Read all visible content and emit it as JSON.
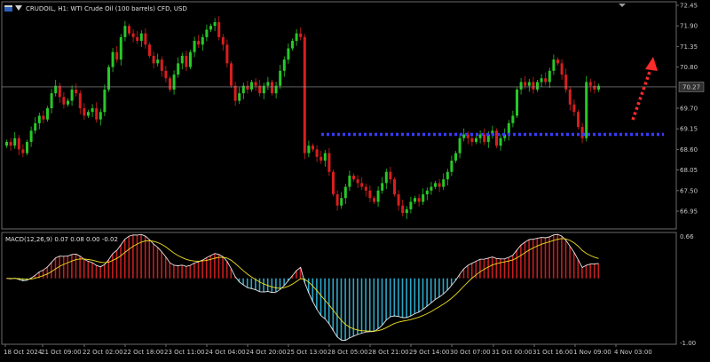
{
  "window": {
    "title": "CRUDOIL, H1: WTI Crude Oil (100 barrels) CFD, USD",
    "macd_label": "MACD(12,26,9) 0.07 0.08 0.00 -0.02"
  },
  "colors": {
    "background": "#000000",
    "bull": "#27c827",
    "bear": "#d81e1e",
    "support_line": "#3a3aff",
    "arrow": "#ff2a2a",
    "macd_line": "#e8e8e8",
    "signal_line": "#f0e020",
    "hist_pos": "#c81e1e",
    "hist_neg": "#2aa7c8",
    "bid_line": "#9a9a9a"
  },
  "icons": [
    "chart-flag-icon",
    "dropdown-arrow-icon"
  ],
  "current_price": "70.27",
  "chart_data": {
    "type": "candlestick",
    "title": "CRUDOIL, H1: WTI Crude Oil (100 barrels) CFD, USD",
    "y_ticks": [
      "72.45",
      "71.90",
      "71.35",
      "70.80",
      "70.27",
      "69.70",
      "69.15",
      "68.60",
      "68.05",
      "67.50",
      "66.95"
    ],
    "y_range": [
      66.5,
      72.5
    ],
    "x_ticks": [
      "18 Oct 2024",
      "21 Oct 09:00",
      "22 Oct 02:00",
      "22 Oct 18:00",
      "23 Oct 11:00",
      "24 Oct 04:00",
      "24 Oct 20:00",
      "25 Oct 13:00",
      "28 Oct 05:00",
      "28 Oct 21:00",
      "29 Oct 14:00",
      "30 Oct 07:00",
      "31 Oct 00:00",
      "31 Oct 16:00",
      "1 Nov 09:00",
      "4 Nov 03:00"
    ],
    "support_level": 69.0,
    "bid_level": 70.27,
    "closes": [
      68.8,
      68.7,
      68.9,
      68.6,
      68.5,
      68.8,
      69.1,
      69.3,
      69.5,
      69.4,
      69.7,
      70.1,
      70.3,
      70.0,
      69.8,
      69.9,
      70.2,
      70.1,
      69.7,
      69.5,
      69.6,
      69.7,
      69.4,
      69.6,
      70.2,
      70.8,
      71.2,
      71.0,
      71.6,
      71.9,
      71.7,
      71.6,
      71.5,
      71.7,
      71.4,
      71.1,
      70.9,
      71.0,
      70.7,
      70.5,
      70.2,
      70.6,
      70.9,
      71.1,
      70.8,
      71.2,
      71.5,
      71.4,
      71.6,
      71.8,
      71.9,
      72.0,
      71.6,
      71.4,
      70.9,
      70.3,
      69.9,
      70.1,
      70.3,
      70.2,
      70.4,
      70.3,
      70.1,
      70.3,
      70.4,
      70.1,
      70.3,
      70.7,
      71.0,
      71.3,
      71.5,
      71.7,
      71.6,
      68.5,
      68.7,
      68.6,
      68.4,
      68.3,
      68.5,
      68.0,
      67.4,
      67.1,
      67.3,
      67.6,
      67.9,
      67.8,
      67.7,
      67.6,
      67.5,
      67.3,
      67.2,
      67.5,
      67.7,
      68.0,
      67.8,
      67.4,
      67.1,
      66.9,
      67.0,
      67.2,
      67.3,
      67.2,
      67.4,
      67.5,
      67.6,
      67.7,
      67.6,
      67.8,
      68.0,
      68.3,
      68.5,
      68.9,
      69.0,
      68.9,
      68.8,
      68.9,
      69.0,
      68.8,
      69.0,
      69.1,
      68.7,
      68.9,
      69.0,
      69.3,
      69.5,
      70.2,
      70.4,
      70.3,
      70.4,
      70.2,
      70.4,
      70.5,
      70.4,
      70.7,
      71.0,
      70.9,
      70.6,
      70.2,
      69.8,
      69.6,
      69.2,
      68.9,
      70.4,
      70.3,
      70.2,
      70.3
    ],
    "macd_range": [
      -1.0,
      0.66
    ],
    "macd_ticks": [
      "0.66",
      "-1.00"
    ]
  }
}
